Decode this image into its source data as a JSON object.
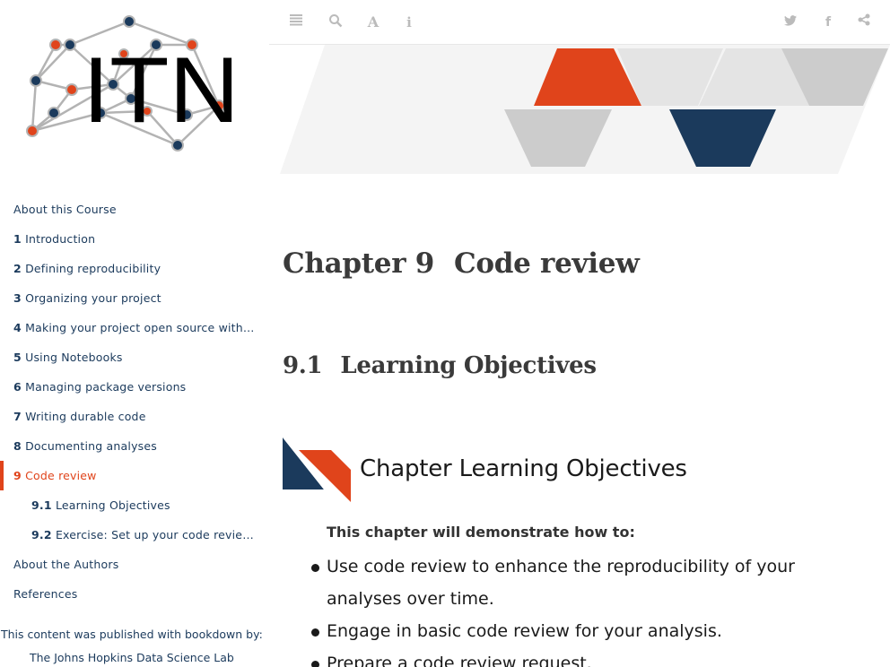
{
  "logo": {
    "text": "ITN",
    "colors": {
      "node_red": "#e0441b",
      "node_blue": "#1b3a5c",
      "edge": "#b3b3b3"
    }
  },
  "toc": [
    {
      "num": "",
      "label": "About this Course",
      "active": false,
      "sub": false
    },
    {
      "num": "1",
      "label": "Introduction",
      "active": false,
      "sub": false
    },
    {
      "num": "2",
      "label": "Defining reproducibility",
      "active": false,
      "sub": false
    },
    {
      "num": "3",
      "label": "Organizing your project",
      "active": false,
      "sub": false
    },
    {
      "num": "4",
      "label": "Making your project open source with …",
      "active": false,
      "sub": false
    },
    {
      "num": "5",
      "label": "Using Notebooks",
      "active": false,
      "sub": false
    },
    {
      "num": "6",
      "label": "Managing package versions",
      "active": false,
      "sub": false
    },
    {
      "num": "7",
      "label": "Writing durable code",
      "active": false,
      "sub": false
    },
    {
      "num": "8",
      "label": "Documenting analyses",
      "active": false,
      "sub": false
    },
    {
      "num": "9",
      "label": "Code review",
      "active": true,
      "sub": false
    },
    {
      "num": "9.1",
      "label": "Learning Objectives",
      "active": false,
      "sub": true
    },
    {
      "num": "9.2",
      "label": "Exercise: Set up your code review …",
      "active": false,
      "sub": true
    },
    {
      "num": "",
      "label": "About the Authors",
      "active": false,
      "sub": false
    },
    {
      "num": "",
      "label": "References",
      "active": false,
      "sub": false
    }
  ],
  "publish": {
    "text": "This content was published with bookdown by:",
    "link": "The Johns Hopkins Data Science Lab"
  },
  "toolbar": {
    "left": [
      {
        "name": "sidebar-toggle-icon",
        "glyph": "≣"
      },
      {
        "name": "search-icon",
        "glyph": "⌕"
      },
      {
        "name": "font-settings-icon",
        "glyph": "A"
      },
      {
        "name": "info-icon",
        "glyph": "i"
      }
    ],
    "right": [
      {
        "name": "twitter-icon",
        "glyph": "t"
      },
      {
        "name": "facebook-icon",
        "glyph": "f"
      },
      {
        "name": "share-icon",
        "glyph": "<"
      }
    ]
  },
  "chapter": {
    "num": "Chapter 9",
    "title": "Code review"
  },
  "section": {
    "num": "9.1",
    "title": "Learning Objectives"
  },
  "objectives": {
    "title": "Chapter Learning Objectives",
    "lead": "This chapter will demonstrate how to:",
    "items": [
      "Use code review to enhance the reproducibility of your analyses over time.",
      "Engage in basic code review for your analysis.",
      "Prepare a code review request."
    ]
  },
  "colors": {
    "accent": "#e0441b",
    "navy": "#1b3a5c",
    "banner_gray": "#cccccc",
    "banner_light": "#e4e4e4"
  }
}
